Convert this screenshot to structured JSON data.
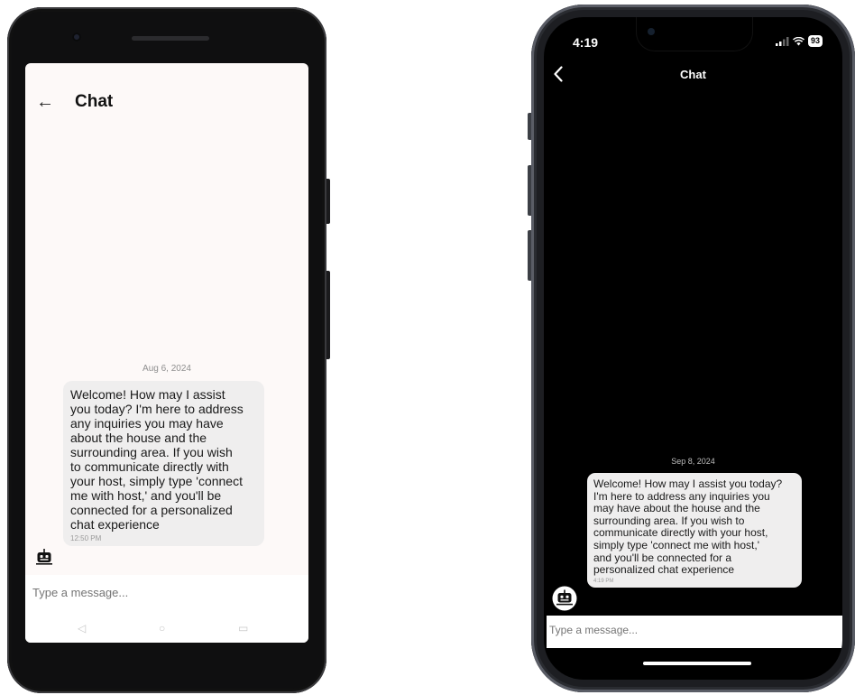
{
  "android": {
    "header": {
      "back_glyph": "←",
      "title": "Chat"
    },
    "date": "Aug 6, 2024",
    "message": {
      "text": "Welcome! How may I assist\nyou today?  I'm here to address\nany inquiries you may have\nabout the house and the\nsurrounding area. If you wish\nto communicate directly with\nyour host, simply type 'connect\nme with host,' and you'll be\nconnected for a personalized\nchat experience",
      "time": "12:50 PM"
    },
    "input": {
      "placeholder": "Type a message..."
    },
    "nav": {
      "back": "◁",
      "home": "○",
      "recents": "▭"
    },
    "icons": {
      "avatar": "robot-icon",
      "back": "arrow-left-icon"
    }
  },
  "iphone": {
    "status": {
      "time": "4:19",
      "battery": "93",
      "signal_icon": "signal-icon",
      "wifi_icon": "wifi-icon"
    },
    "header": {
      "title": "Chat",
      "back_icon": "chevron-left-icon"
    },
    "date": "Sep 8, 2024",
    "message": {
      "text": "Welcome! How may I assist you today?\nI'm here to address any inquiries you\nmay have about the house and the\nsurrounding area. If you wish to\ncommunicate directly with your host,\nsimply type 'connect me with host,'\nand you'll be connected for a\npersonalized chat experience",
      "time": "4:19 PM"
    },
    "input": {
      "placeholder": "Type a message..."
    },
    "icons": {
      "avatar": "robot-icon"
    }
  },
  "colors": {
    "android_screen_bg": "#fdf9f8",
    "iphone_screen_bg": "#000000",
    "bubble_bg": "#efeeee",
    "text_dark": "#1a1a1a"
  }
}
